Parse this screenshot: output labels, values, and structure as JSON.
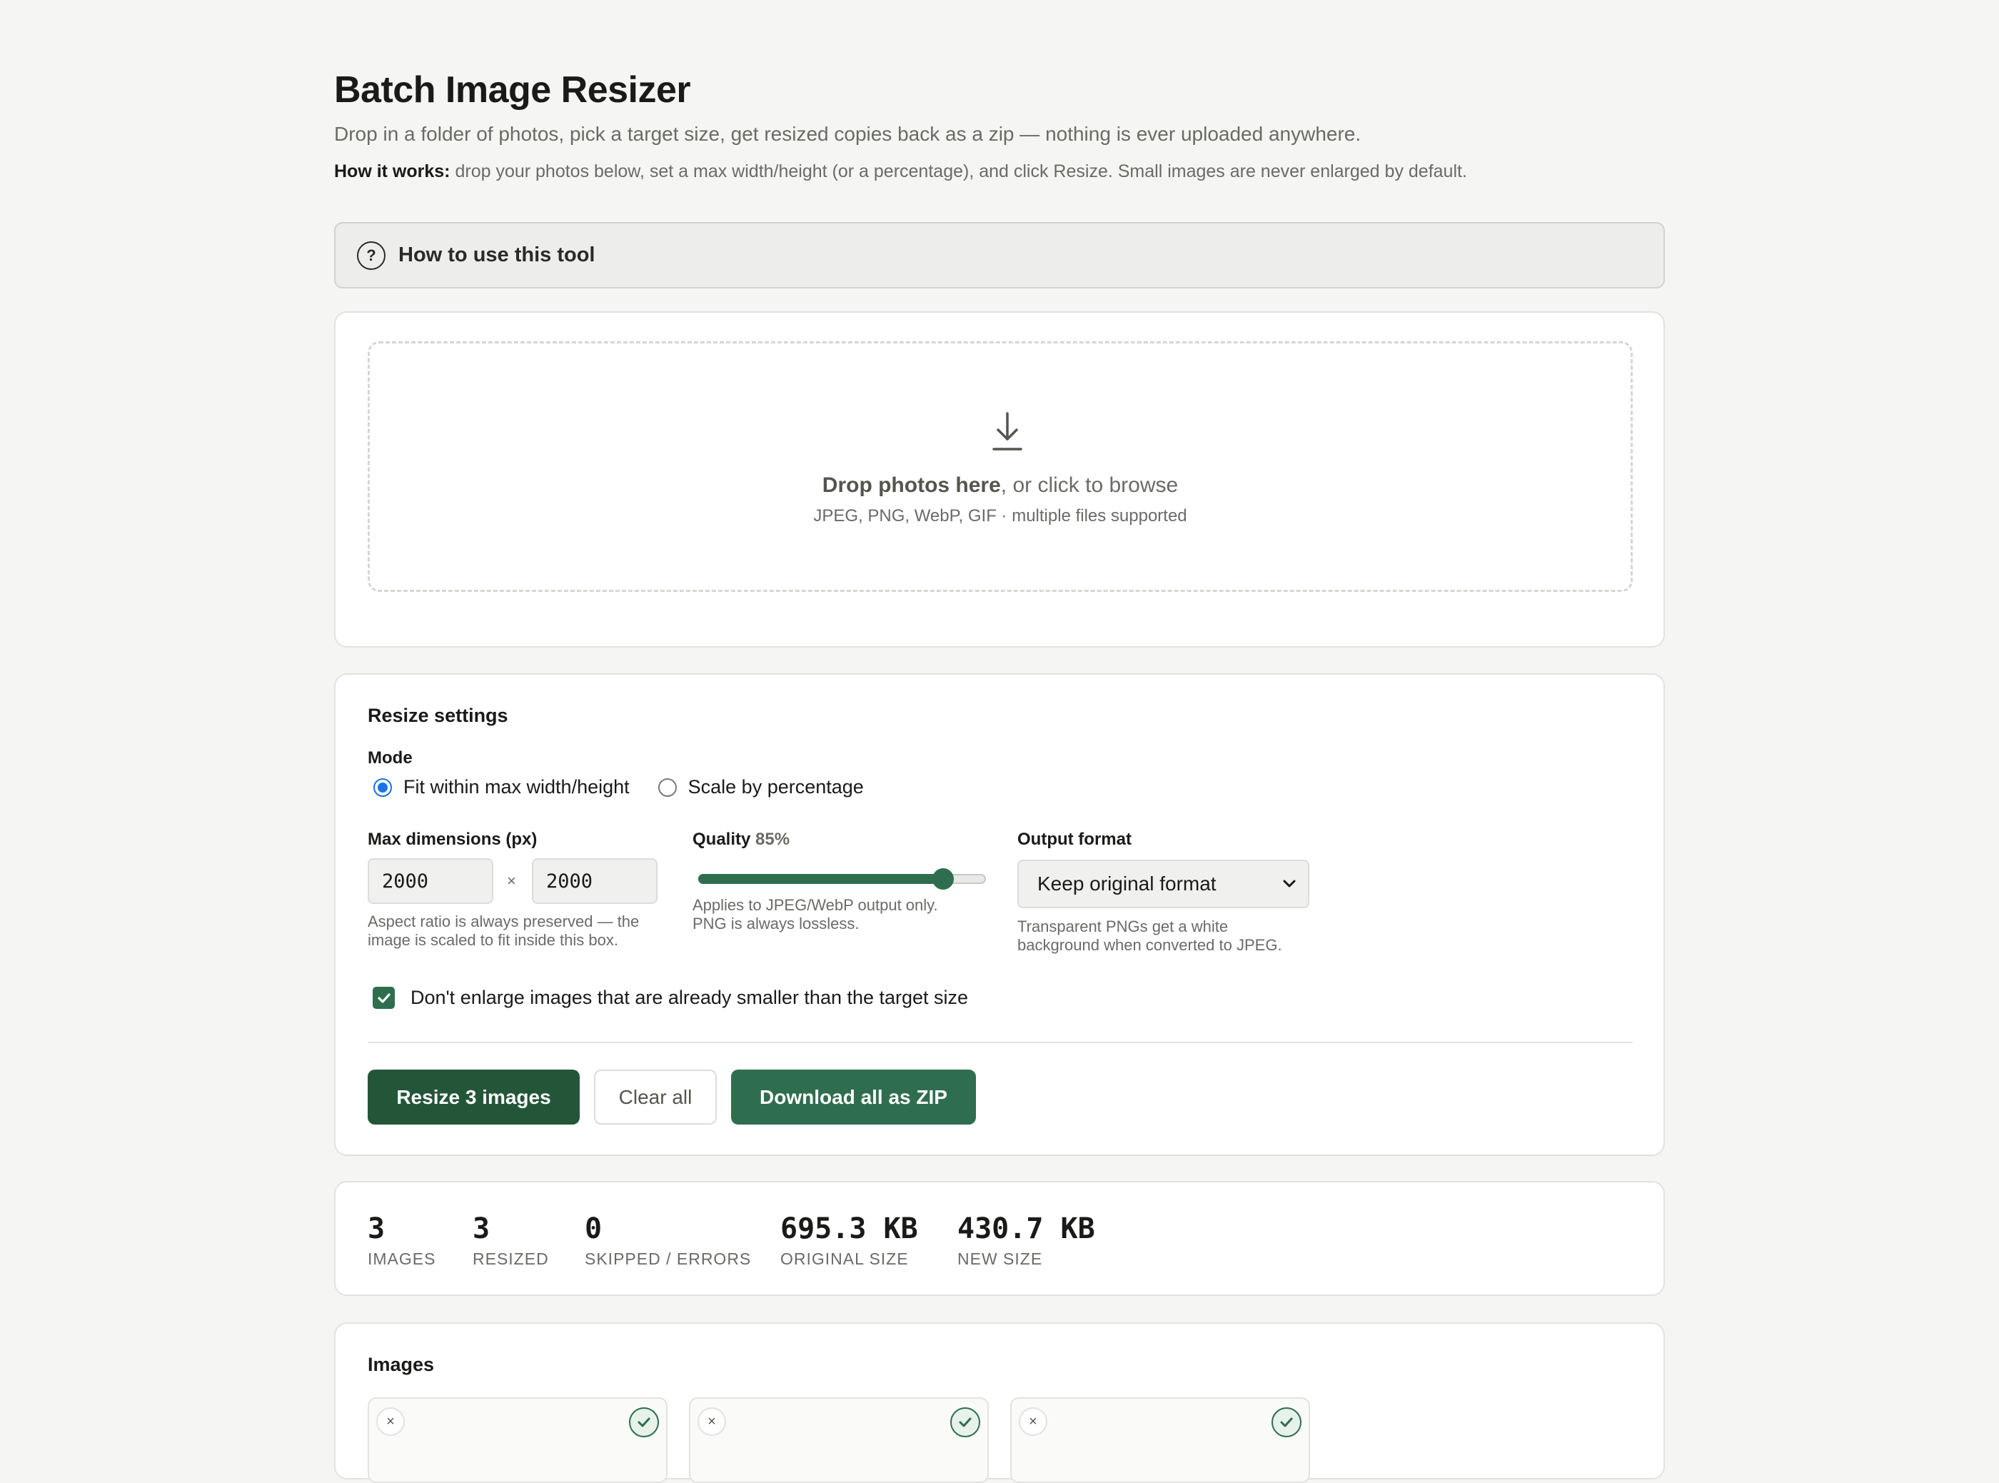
{
  "header": {
    "title": "Batch Image Resizer",
    "subtitle": "Drop in a folder of photos, pick a target size, get resized copies back as a zip — nothing is ever uploaded anywhere.",
    "how_label": "How it works:",
    "how_text": " drop your photos below, set a max width/height (or a percentage), and click Resize. Small images are never enlarged by default."
  },
  "help": {
    "label": "How to use this tool",
    "icon": "question-circle-icon"
  },
  "dropzone": {
    "icon": "download-arrow-icon",
    "main_bold": "Drop photos here",
    "main_rest": ", or click to browse",
    "sub": "JPEG, PNG, WebP, GIF · multiple files supported"
  },
  "settings": {
    "title": "Resize settings",
    "mode_label": "Mode",
    "modes": [
      {
        "label": "Fit within max width/height",
        "selected": true
      },
      {
        "label": "Scale by percentage",
        "selected": false
      }
    ],
    "max_dims_label": "Max dimensions (px)",
    "max_width": "2000",
    "max_height": "2000",
    "times": "×",
    "max_dims_hint_1": "Aspect ratio is always preserved — the",
    "max_dims_hint_2": "image is scaled to fit inside this box.",
    "quality_label": "Quality",
    "quality_value": "85%",
    "quality_fraction": 0.85,
    "quality_hint_1": "Applies to JPEG/WebP output only.",
    "quality_hint_2": "PNG is always lossless.",
    "format_label": "Output format",
    "format_value": "Keep original format",
    "format_hint_1": "Transparent PNGs get a white",
    "format_hint_2": "background when converted to JPEG.",
    "no_enlarge_label": "Don't enlarge images that are already smaller than the target size",
    "no_enlarge_checked": true
  },
  "actions": {
    "resize": "Resize 3 images",
    "clear": "Clear all",
    "download": "Download all as ZIP"
  },
  "stats": [
    {
      "value": "3",
      "label": "Images"
    },
    {
      "value": "3",
      "label": "Resized"
    },
    {
      "value": "0",
      "label": "Skipped / Errors"
    },
    {
      "value": "695.3 KB",
      "label": "Original size"
    },
    {
      "value": "430.7 KB",
      "label": "New size"
    }
  ],
  "images": {
    "title": "Images",
    "remove_glyph": "×",
    "items": [
      {
        "status": "done"
      },
      {
        "status": "done"
      },
      {
        "status": "done"
      }
    ]
  },
  "colors": {
    "accent": "#2e6e4e",
    "accent_dark": "#235639",
    "radio_blue": "#1a73e8",
    "background": "#f5f5f3"
  }
}
